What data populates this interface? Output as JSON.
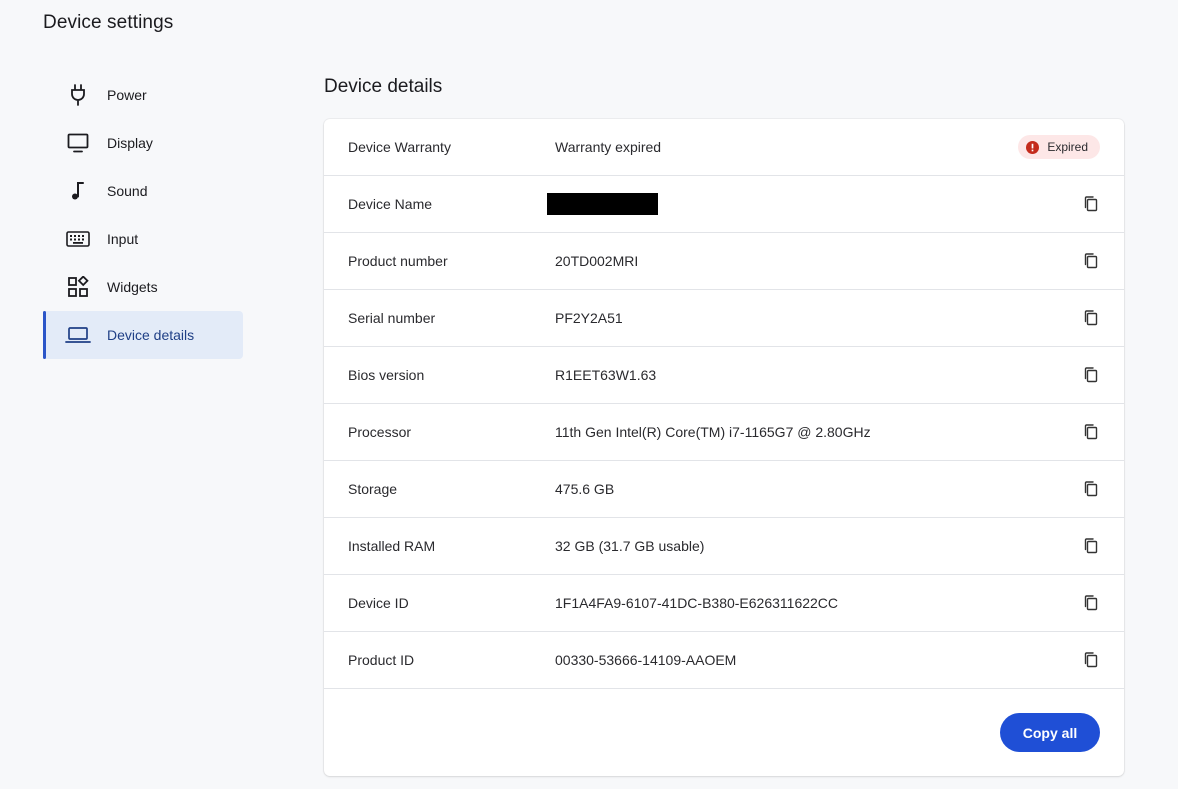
{
  "app": {
    "title": "Device settings"
  },
  "sidebar": {
    "items": [
      {
        "label": "Power",
        "icon": "plug-icon"
      },
      {
        "label": "Display",
        "icon": "monitor-icon"
      },
      {
        "label": "Sound",
        "icon": "music-note-icon"
      },
      {
        "label": "Input",
        "icon": "keyboard-icon"
      },
      {
        "label": "Widgets",
        "icon": "widgets-icon"
      },
      {
        "label": "Device details",
        "icon": "laptop-icon",
        "active": true
      }
    ]
  },
  "main": {
    "title": "Device details",
    "warranty": {
      "label": "Device Warranty",
      "value": "Warranty expired",
      "badge": "Expired"
    },
    "rows": [
      {
        "label": "Device Name",
        "value": ""
      },
      {
        "label": "Product number",
        "value": "20TD002MRI"
      },
      {
        "label": "Serial number",
        "value": "PF2Y2A51"
      },
      {
        "label": "Bios version",
        "value": "R1EET63W1.63"
      },
      {
        "label": "Processor",
        "value": "11th Gen Intel(R) Core(TM) i7-1165G7 @ 2.80GHz"
      },
      {
        "label": "Storage",
        "value": "475.6 GB"
      },
      {
        "label": "Installed RAM",
        "value": "32 GB (31.7 GB usable)"
      },
      {
        "label": "Device ID",
        "value": "1F1A4FA9-6107-41DC-B380-E626311622CC"
      },
      {
        "label": "Product ID",
        "value": "00330-53666-14109-AAOEM"
      }
    ],
    "copy_all_label": "Copy all"
  },
  "colors": {
    "accent": "#1f4fd6",
    "active_bg": "#e3ebf8",
    "badge_bg": "#fde7e7",
    "badge_icon": "#c42b1c"
  }
}
